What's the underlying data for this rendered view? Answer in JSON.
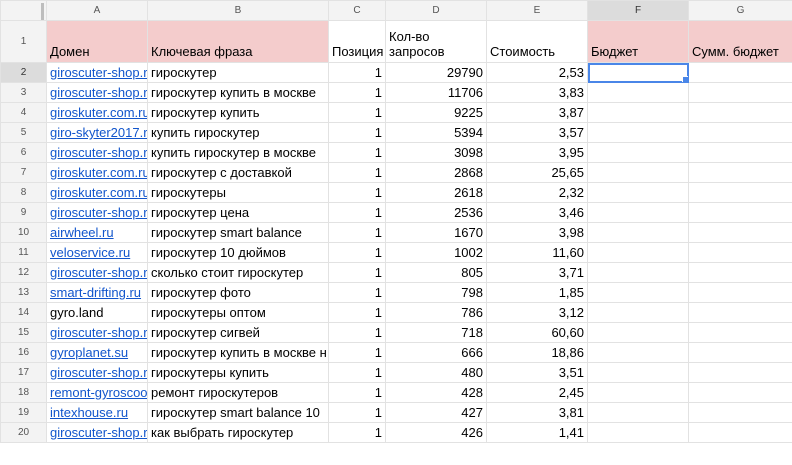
{
  "columns": [
    "A",
    "B",
    "C",
    "D",
    "E",
    "F",
    "G"
  ],
  "header_row_number": "1",
  "headers": {
    "domain": "Домен",
    "phrase": "Ключевая фраза",
    "position": "Позиция",
    "requests_line1": "Кол-во",
    "requests_line2": "запросов",
    "cost": "Стоимость",
    "budget": "Бюджет",
    "sum_budget": "Сумм. бюджет"
  },
  "rows": [
    {
      "n": "2",
      "domain": "giroscuter-shop.r",
      "phrase": "гироскутер",
      "position": "1",
      "requests": "29790",
      "cost": "2,53"
    },
    {
      "n": "3",
      "domain": "giroscuter-shop.r",
      "phrase": "гироскутер купить в москве",
      "position": "1",
      "requests": "11706",
      "cost": "3,83"
    },
    {
      "n": "4",
      "domain": "giroskuter.com.ru",
      "phrase": "гироскутер купить",
      "position": "1",
      "requests": "9225",
      "cost": "3,87"
    },
    {
      "n": "5",
      "domain": "giro-skyter2017.r",
      "phrase": "купить гироскутер",
      "position": "1",
      "requests": "5394",
      "cost": "3,57"
    },
    {
      "n": "6",
      "domain": "giroscuter-shop.r",
      "phrase": "купить гироскутер в москве",
      "position": "1",
      "requests": "3098",
      "cost": "3,95"
    },
    {
      "n": "7",
      "domain": "giroskuter.com.ru",
      "phrase": "гироскутер с доставкой",
      "position": "1",
      "requests": "2868",
      "cost": "25,65"
    },
    {
      "n": "8",
      "domain": "giroskuter.com.ru",
      "phrase": "гироскутеры",
      "position": "1",
      "requests": "2618",
      "cost": "2,32"
    },
    {
      "n": "9",
      "domain": "giroscuter-shop.r",
      "phrase": "гироскутер цена",
      "position": "1",
      "requests": "2536",
      "cost": "3,46"
    },
    {
      "n": "10",
      "domain": "airwheel.ru",
      "phrase": "гироскутер smart balance",
      "position": "1",
      "requests": "1670",
      "cost": "3,98"
    },
    {
      "n": "11",
      "domain": "veloservice.ru",
      "phrase": "гироскутер 10 дюймов",
      "position": "1",
      "requests": "1002",
      "cost": "11,60"
    },
    {
      "n": "12",
      "domain": "giroscuter-shop.r",
      "phrase": "сколько стоит гироскутер",
      "position": "1",
      "requests": "805",
      "cost": "3,71"
    },
    {
      "n": "13",
      "domain": "smart-drifting.ru",
      "phrase": "гироскутер фото",
      "position": "1",
      "requests": "798",
      "cost": "1,85"
    },
    {
      "n": "14",
      "domain": "gyro.land",
      "phrase": "гироскутеры оптом",
      "position": "1",
      "requests": "786",
      "cost": "3,12"
    },
    {
      "n": "15",
      "domain": "giroscuter-shop.r",
      "phrase": "гироскутер сигвей",
      "position": "1",
      "requests": "718",
      "cost": "60,60"
    },
    {
      "n": "16",
      "domain": "gyroplanet.su",
      "phrase": "гироскутер купить в москве н",
      "position": "1",
      "requests": "666",
      "cost": "18,86"
    },
    {
      "n": "17",
      "domain": "giroscuter-shop.r",
      "phrase": "гироскутеры купить",
      "position": "1",
      "requests": "480",
      "cost": "3,51"
    },
    {
      "n": "18",
      "domain": "remont-gyroscoo",
      "phrase": "ремонт гироскутеров",
      "position": "1",
      "requests": "428",
      "cost": "2,45"
    },
    {
      "n": "19",
      "domain": "intexhouse.ru",
      "phrase": "гироскутер smart balance 10",
      "position": "1",
      "requests": "427",
      "cost": "3,81"
    },
    {
      "n": "20",
      "domain": "giroscuter-shop.r",
      "phrase": "как выбрать гироскутер",
      "position": "1",
      "requests": "426",
      "cost": "1,41"
    }
  ],
  "linked_domains": [
    "giroscuter-shop.r",
    "giroskuter.com.ru",
    "giro-skyter2017.r",
    "airwheel.ru",
    "veloservice.ru",
    "smart-drifting.ru",
    "gyroplanet.su",
    "remont-gyroscoo",
    "intexhouse.ru"
  ],
  "active_cell": "F2",
  "colors": {
    "link": "#1155cc",
    "header_fill": "#f4cccc",
    "selection": "#4a86e8"
  }
}
